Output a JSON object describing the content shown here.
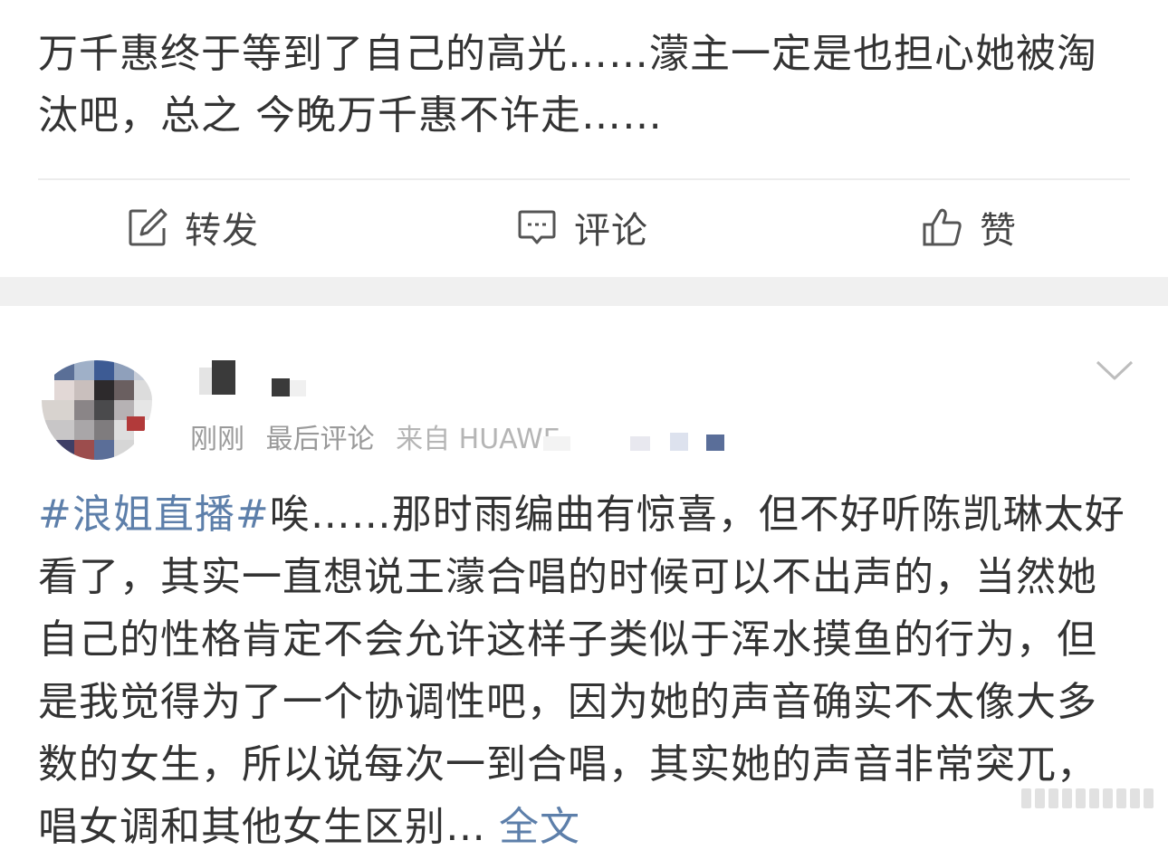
{
  "post": {
    "text": "万千惠终于等到了自己的高光……濛主一定是也担心她被淘汰吧，总之 今晚万千惠不许走……",
    "actions": {
      "repost_label": "转发",
      "comment_label": "评论",
      "like_label": "赞"
    }
  },
  "comment": {
    "meta_time": "刚刚",
    "meta_last_comment": "最后评论",
    "meta_source": "来自 HUAWEI",
    "hashtag": "#浪姐直播#",
    "text": "唉……那时雨编曲有惊喜，但不好听陈凯琳太好看了，其实一直想说王濛合唱的时候可以不出声的，当然她自己的性格肯定不会允许这样子类似于浑水摸鱼的行为，但是我觉得为了一个协调性吧，因为她的声音确实不太像大多数的女生，所以说每次一到合唱，其实她的声音非常突兀，唱女调和其他女生区别…",
    "more_label": "全文"
  },
  "icons": {
    "repost": "edit-square-icon",
    "comment": "comment-bubble-icon",
    "like": "thumbs-up-icon",
    "expand": "chevron-down-icon"
  },
  "colors": {
    "link": "#5d7faa",
    "text": "#333333",
    "meta": "#9a9a9a",
    "band": "#f0f0f0"
  }
}
